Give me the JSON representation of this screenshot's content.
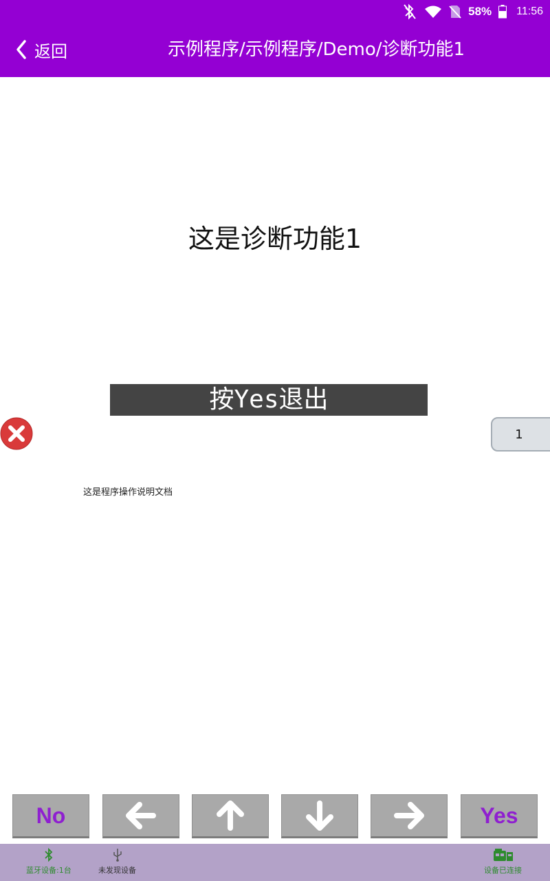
{
  "status_bar": {
    "battery_percent": "58%",
    "time": "11:56",
    "icons": [
      "bluetooth-off-icon",
      "wifi-icon",
      "no-sim-icon",
      "battery-icon"
    ]
  },
  "header": {
    "back_label": "返回",
    "title": "示例程序/示例程序/Demo/诊断功能1",
    "background": "#9400d3"
  },
  "main": {
    "heading": "这是诊断功能1",
    "prompt": "按Yes退出",
    "page_indicator": "1",
    "doc_text": "这是程序操作说明文档"
  },
  "actions": [
    {
      "label": "No",
      "icon": "",
      "type": "text"
    },
    {
      "label": "",
      "icon": "arrow-left-icon",
      "type": "icon"
    },
    {
      "label": "",
      "icon": "arrow-up-icon",
      "type": "icon"
    },
    {
      "label": "",
      "icon": "arrow-down-icon",
      "type": "icon"
    },
    {
      "label": "",
      "icon": "arrow-right-icon",
      "type": "icon"
    },
    {
      "label": "Yes",
      "icon": "",
      "type": "text"
    }
  ],
  "bottom_bar": {
    "bluetooth_label": "蓝牙设备:1台",
    "usb_label": "未发现设备",
    "connection_label": "设备已连接",
    "bluetooth_color": "#2e8b2e",
    "usb_color": "#333333",
    "connection_color": "#2e8b2e"
  }
}
